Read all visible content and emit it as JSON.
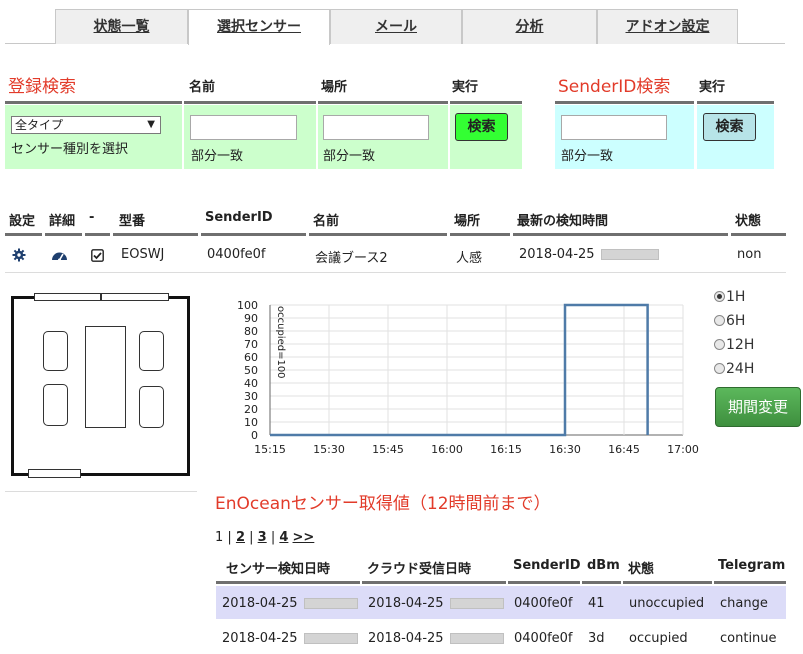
{
  "tabs": [
    {
      "label": "状態一覧",
      "active": false
    },
    {
      "label": "選択センサー",
      "active": true
    },
    {
      "label": "メール",
      "active": false
    },
    {
      "label": "分析",
      "active": false
    },
    {
      "label": "アドオン設定",
      "active": false
    }
  ],
  "register_search": {
    "title": "登録検索",
    "col_name": "名前",
    "col_place": "場所",
    "col_exec": "実行",
    "type_select_value": "全タイプ",
    "type_select_hint": "センサー種別を選択",
    "name_value": "",
    "name_hint": "部分一致",
    "place_value": "",
    "place_hint": "部分一致",
    "search_button": "検索",
    "colors": {
      "panel": "#ccffcc",
      "button": "#33ff33"
    }
  },
  "senderid_search": {
    "title": "SenderID検索",
    "col_exec": "実行",
    "senderid_value": "",
    "hint": "部分一致",
    "search_button": "検索",
    "colors": {
      "panel": "#ccffff",
      "button": "#b7e4e8"
    }
  },
  "sensor_table": {
    "headers": [
      "設定",
      "詳細",
      "-",
      "型番",
      "SenderID",
      "名前",
      "場所",
      "最新の検知時間",
      "状態"
    ],
    "row": {
      "settings_icon": "gear-icon",
      "detail_icon": "gauge-icon",
      "select_icon": "checkbox-checked-icon",
      "model": "EOSWJ",
      "sender_id": "0400fe0f",
      "name": "会議ブース2",
      "place": "人感",
      "last_detected": "2018-04-25",
      "status": "non"
    }
  },
  "chart_data": {
    "type": "line",
    "series": [
      {
        "x": [
          "15:15",
          "16:30",
          "16:30",
          "16:51",
          "16:51"
        ],
        "y": [
          0,
          0,
          100,
          100,
          0
        ]
      }
    ],
    "annotation": "occupied=100",
    "x_ticks": [
      "15:15",
      "15:30",
      "15:45",
      "16:00",
      "16:15",
      "16:30",
      "16:45",
      "17:00"
    ],
    "y_ticks": [
      0,
      10,
      20,
      30,
      40,
      50,
      60,
      70,
      80,
      90,
      100
    ],
    "xlim": [
      "15:15",
      "17:00"
    ],
    "ylim": [
      0,
      100
    ],
    "grid": true,
    "line_color": "#4f7ba8"
  },
  "period": {
    "options": [
      "1H",
      "6H",
      "12H",
      "24H"
    ],
    "selected": "1H",
    "change_button": "期間変更"
  },
  "log": {
    "title": "EnOceanセンサー取得値（12時間前まで）",
    "pager": {
      "current": "1",
      "pages": [
        "2",
        "3",
        "4"
      ],
      "next": ">>"
    },
    "headers": [
      "センサー検知日時",
      "クラウド受信日時",
      "SenderID",
      "dBm",
      "状態",
      "Telegram"
    ],
    "rows": [
      {
        "detected": "2018-04-25",
        "received": "2018-04-25",
        "sender_id": "0400fe0f",
        "dbm": "41",
        "state": "unoccupied",
        "telegram": "change"
      },
      {
        "detected": "2018-04-25",
        "received": "2018-04-25",
        "sender_id": "0400fe0f",
        "dbm": "3d",
        "state": "occupied",
        "telegram": "continue"
      }
    ],
    "colors": {
      "highlight_row": "#dcdcf8"
    }
  }
}
